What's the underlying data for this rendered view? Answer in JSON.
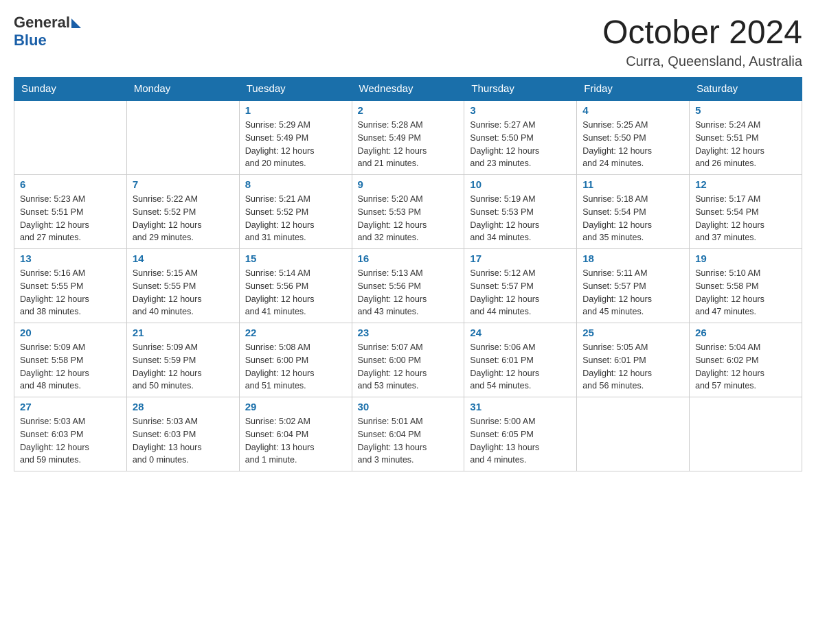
{
  "header": {
    "logo_general": "General",
    "logo_blue": "Blue",
    "month_title": "October 2024",
    "location": "Curra, Queensland, Australia"
  },
  "columns": [
    "Sunday",
    "Monday",
    "Tuesday",
    "Wednesday",
    "Thursday",
    "Friday",
    "Saturday"
  ],
  "weeks": [
    [
      {
        "day": "",
        "info": ""
      },
      {
        "day": "",
        "info": ""
      },
      {
        "day": "1",
        "info": "Sunrise: 5:29 AM\nSunset: 5:49 PM\nDaylight: 12 hours\nand 20 minutes."
      },
      {
        "day": "2",
        "info": "Sunrise: 5:28 AM\nSunset: 5:49 PM\nDaylight: 12 hours\nand 21 minutes."
      },
      {
        "day": "3",
        "info": "Sunrise: 5:27 AM\nSunset: 5:50 PM\nDaylight: 12 hours\nand 23 minutes."
      },
      {
        "day": "4",
        "info": "Sunrise: 5:25 AM\nSunset: 5:50 PM\nDaylight: 12 hours\nand 24 minutes."
      },
      {
        "day": "5",
        "info": "Sunrise: 5:24 AM\nSunset: 5:51 PM\nDaylight: 12 hours\nand 26 minutes."
      }
    ],
    [
      {
        "day": "6",
        "info": "Sunrise: 5:23 AM\nSunset: 5:51 PM\nDaylight: 12 hours\nand 27 minutes."
      },
      {
        "day": "7",
        "info": "Sunrise: 5:22 AM\nSunset: 5:52 PM\nDaylight: 12 hours\nand 29 minutes."
      },
      {
        "day": "8",
        "info": "Sunrise: 5:21 AM\nSunset: 5:52 PM\nDaylight: 12 hours\nand 31 minutes."
      },
      {
        "day": "9",
        "info": "Sunrise: 5:20 AM\nSunset: 5:53 PM\nDaylight: 12 hours\nand 32 minutes."
      },
      {
        "day": "10",
        "info": "Sunrise: 5:19 AM\nSunset: 5:53 PM\nDaylight: 12 hours\nand 34 minutes."
      },
      {
        "day": "11",
        "info": "Sunrise: 5:18 AM\nSunset: 5:54 PM\nDaylight: 12 hours\nand 35 minutes."
      },
      {
        "day": "12",
        "info": "Sunrise: 5:17 AM\nSunset: 5:54 PM\nDaylight: 12 hours\nand 37 minutes."
      }
    ],
    [
      {
        "day": "13",
        "info": "Sunrise: 5:16 AM\nSunset: 5:55 PM\nDaylight: 12 hours\nand 38 minutes."
      },
      {
        "day": "14",
        "info": "Sunrise: 5:15 AM\nSunset: 5:55 PM\nDaylight: 12 hours\nand 40 minutes."
      },
      {
        "day": "15",
        "info": "Sunrise: 5:14 AM\nSunset: 5:56 PM\nDaylight: 12 hours\nand 41 minutes."
      },
      {
        "day": "16",
        "info": "Sunrise: 5:13 AM\nSunset: 5:56 PM\nDaylight: 12 hours\nand 43 minutes."
      },
      {
        "day": "17",
        "info": "Sunrise: 5:12 AM\nSunset: 5:57 PM\nDaylight: 12 hours\nand 44 minutes."
      },
      {
        "day": "18",
        "info": "Sunrise: 5:11 AM\nSunset: 5:57 PM\nDaylight: 12 hours\nand 45 minutes."
      },
      {
        "day": "19",
        "info": "Sunrise: 5:10 AM\nSunset: 5:58 PM\nDaylight: 12 hours\nand 47 minutes."
      }
    ],
    [
      {
        "day": "20",
        "info": "Sunrise: 5:09 AM\nSunset: 5:58 PM\nDaylight: 12 hours\nand 48 minutes."
      },
      {
        "day": "21",
        "info": "Sunrise: 5:09 AM\nSunset: 5:59 PM\nDaylight: 12 hours\nand 50 minutes."
      },
      {
        "day": "22",
        "info": "Sunrise: 5:08 AM\nSunset: 6:00 PM\nDaylight: 12 hours\nand 51 minutes."
      },
      {
        "day": "23",
        "info": "Sunrise: 5:07 AM\nSunset: 6:00 PM\nDaylight: 12 hours\nand 53 minutes."
      },
      {
        "day": "24",
        "info": "Sunrise: 5:06 AM\nSunset: 6:01 PM\nDaylight: 12 hours\nand 54 minutes."
      },
      {
        "day": "25",
        "info": "Sunrise: 5:05 AM\nSunset: 6:01 PM\nDaylight: 12 hours\nand 56 minutes."
      },
      {
        "day": "26",
        "info": "Sunrise: 5:04 AM\nSunset: 6:02 PM\nDaylight: 12 hours\nand 57 minutes."
      }
    ],
    [
      {
        "day": "27",
        "info": "Sunrise: 5:03 AM\nSunset: 6:03 PM\nDaylight: 12 hours\nand 59 minutes."
      },
      {
        "day": "28",
        "info": "Sunrise: 5:03 AM\nSunset: 6:03 PM\nDaylight: 13 hours\nand 0 minutes."
      },
      {
        "day": "29",
        "info": "Sunrise: 5:02 AM\nSunset: 6:04 PM\nDaylight: 13 hours\nand 1 minute."
      },
      {
        "day": "30",
        "info": "Sunrise: 5:01 AM\nSunset: 6:04 PM\nDaylight: 13 hours\nand 3 minutes."
      },
      {
        "day": "31",
        "info": "Sunrise: 5:00 AM\nSunset: 6:05 PM\nDaylight: 13 hours\nand 4 minutes."
      },
      {
        "day": "",
        "info": ""
      },
      {
        "day": "",
        "info": ""
      }
    ]
  ]
}
